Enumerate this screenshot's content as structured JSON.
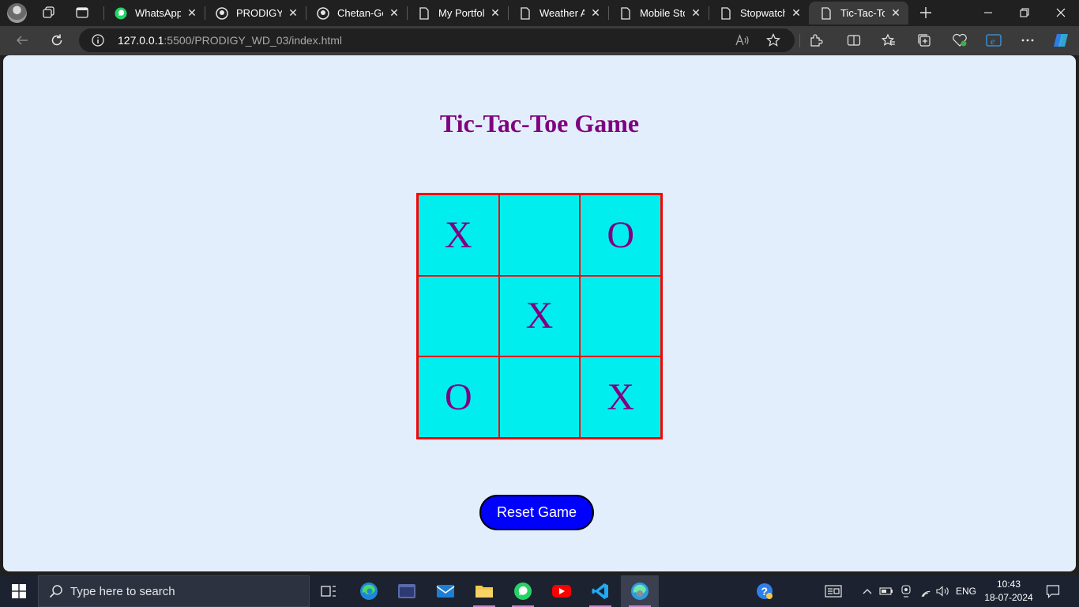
{
  "browser": {
    "tabs": [
      {
        "title": "WhatsApp",
        "icon": "whatsapp-icon"
      },
      {
        "title": "PRODIGY_W",
        "icon": "github-icon"
      },
      {
        "title": "Chetan-Go",
        "icon": "github-icon"
      },
      {
        "title": "My Portfolio",
        "icon": "page-icon"
      },
      {
        "title": "Weather Ap",
        "icon": "page-icon"
      },
      {
        "title": "Mobile Stor",
        "icon": "page-icon"
      },
      {
        "title": "Stopwatch",
        "icon": "page-icon"
      },
      {
        "title": "Tic-Tac-Toe",
        "icon": "page-icon",
        "active": true
      }
    ],
    "address": {
      "host": "127.0.0.1",
      "path": ":5500/PRODIGY_WD_03/index.html"
    }
  },
  "page": {
    "title": "Tic-Tac-Toe Game",
    "board": [
      "X",
      "",
      "O",
      "",
      "X",
      "",
      "O",
      "",
      "X"
    ],
    "reset_label": "Reset Game"
  },
  "taskbar": {
    "search_placeholder": "Type here to search",
    "language": "ENG",
    "time": "10:43",
    "date": "18-07-2024"
  },
  "colors": {
    "page_bg": "#e3eefd",
    "title": "#800080",
    "cell_bg": "#00eeee",
    "cell_border": "#ff0000",
    "button_bg": "#0000ff"
  }
}
